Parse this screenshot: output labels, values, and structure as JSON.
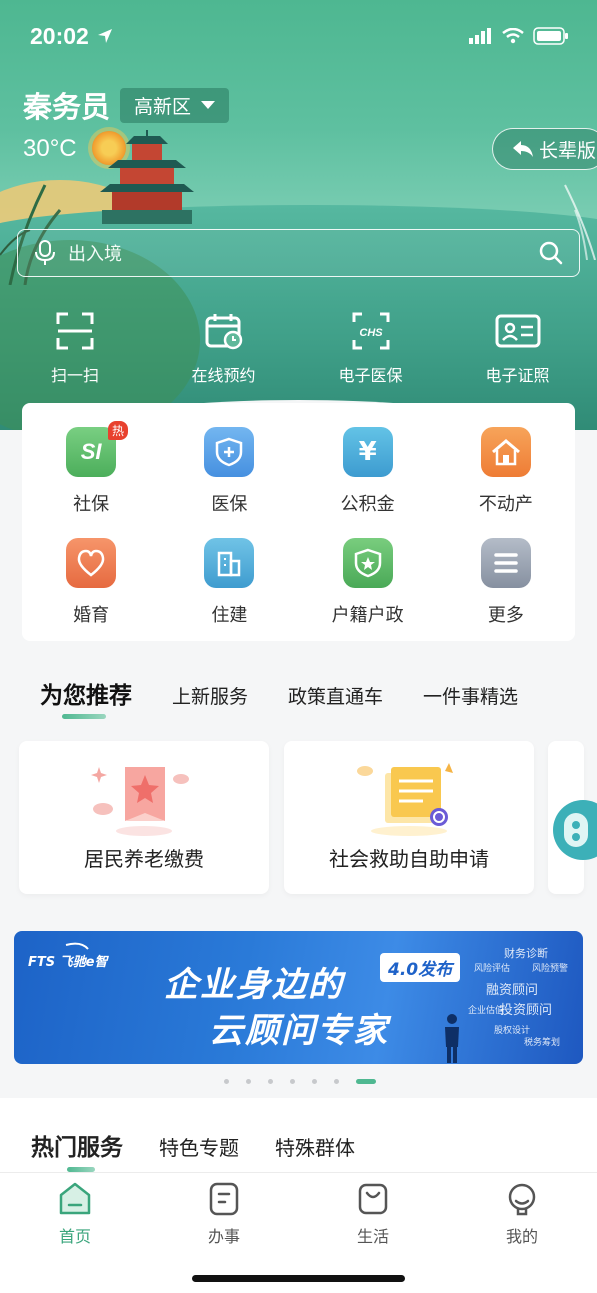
{
  "status_bar": {
    "time": "20:02"
  },
  "header": {
    "user_name": "秦务员",
    "district": "高新区",
    "temperature": "30°C",
    "elder_mode_label": "长辈版"
  },
  "search": {
    "placeholder": "出入境"
  },
  "quick_actions": [
    {
      "label": "扫一扫",
      "icon": "scan-icon"
    },
    {
      "label": "在线预约",
      "icon": "calendar-clock-icon"
    },
    {
      "label": "电子医保",
      "icon": "chs-card-icon"
    },
    {
      "label": "电子证照",
      "icon": "id-card-icon"
    }
  ],
  "services": [
    {
      "label": "社保",
      "icon": "si-icon",
      "color": "#5dbb6a",
      "badge": "热"
    },
    {
      "label": "医保",
      "icon": "medical-shield-icon",
      "color": "#4c9de8"
    },
    {
      "label": "公积金",
      "icon": "yuan-icon",
      "color": "#45a9d6"
    },
    {
      "label": "不动产",
      "icon": "house-icon",
      "color": "#f08a3e"
    },
    {
      "label": "婚育",
      "icon": "heart-icon",
      "color": "#ef7a52"
    },
    {
      "label": "住建",
      "icon": "building-icon",
      "color": "#4aa9d2"
    },
    {
      "label": "户籍户政",
      "icon": "police-badge-icon",
      "color": "#59b463"
    },
    {
      "label": "更多",
      "icon": "more-list-icon",
      "color": "#8f9aa8"
    }
  ],
  "recommend_tabs": [
    "为您推荐",
    "上新服务",
    "政策直通车",
    "一件事精选"
  ],
  "recommend_cards": [
    {
      "title": "居民养老缴费"
    },
    {
      "title": "社会救助自助申请"
    }
  ],
  "banner": {
    "brand": "飞驰e智",
    "brand_prefix": "FTS",
    "line1": "企业身边的",
    "line2": "云顾问专家",
    "badge": "4.0发布",
    "tags": [
      "财务诊断",
      "风险评估",
      "融资顾问",
      "投资顾问",
      "企业估值",
      "风险预警",
      "股权设计",
      "税务筹划"
    ],
    "carousel_pages": 7,
    "active_page": 7
  },
  "hot_tabs": [
    "热门服务",
    "特色专题",
    "特殊群体"
  ],
  "tabbar": [
    {
      "label": "首页",
      "icon": "home-icon",
      "active": true
    },
    {
      "label": "办事",
      "icon": "document-icon",
      "active": false
    },
    {
      "label": "生活",
      "icon": "bag-icon",
      "active": false
    },
    {
      "label": "我的",
      "icon": "profile-icon",
      "active": false
    }
  ],
  "colors": {
    "brand": "#3aa57c",
    "header": "#4eb791",
    "hot_badge": "#e8412e",
    "banner": "#1d63c7"
  }
}
